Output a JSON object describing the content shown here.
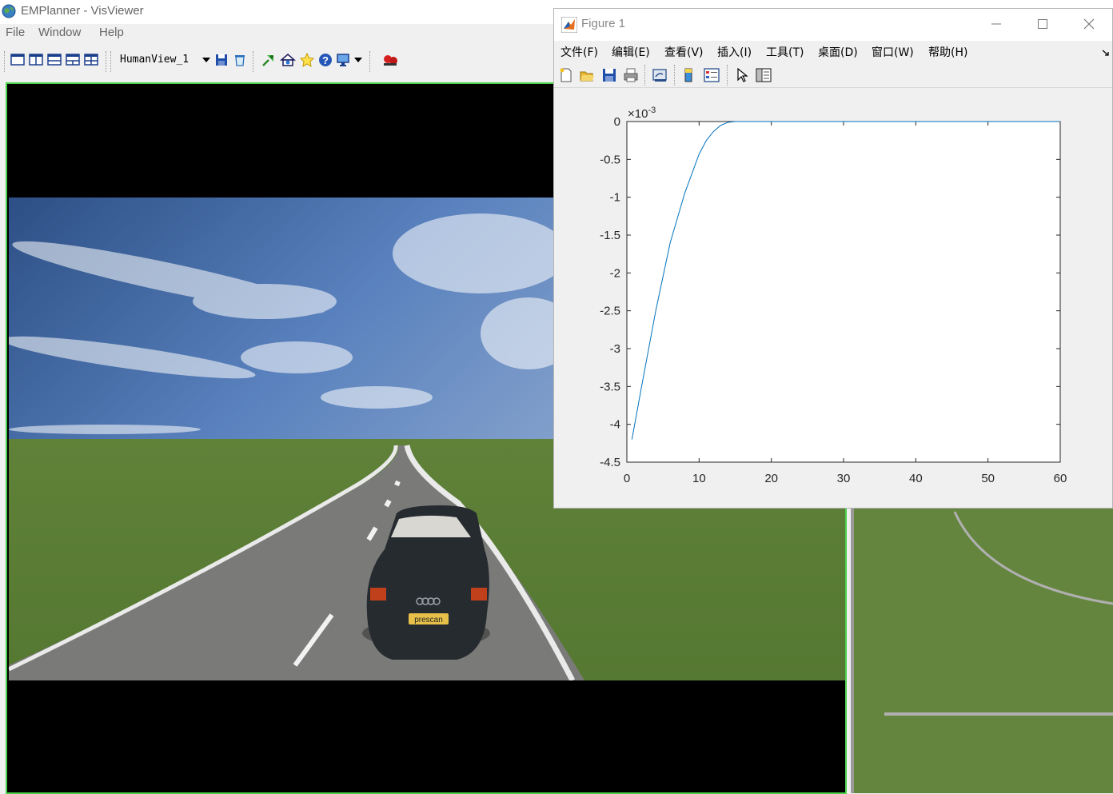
{
  "vis": {
    "title": "EMPlanner - VisViewer",
    "menu": [
      "File",
      "Window",
      "Help"
    ],
    "view_select": "HumanView_1",
    "toolbar_icons": [
      "layout-single-icon",
      "layout-two-columns-icon",
      "layout-two-rows-icon",
      "layout-three-icon",
      "layout-quad-icon",
      "save-icon",
      "delete-icon",
      "pick-icon",
      "home-view-icon",
      "favorite-icon",
      "help-icon",
      "display-icon",
      "record-icon"
    ],
    "plate_text": "prescan"
  },
  "figure": {
    "title": "Figure 1",
    "menu": [
      "文件(F)",
      "编辑(E)",
      "查看(V)",
      "插入(I)",
      "工具(T)",
      "桌面(D)",
      "窗口(W)",
      "帮助(H)"
    ],
    "toolbar_icons": [
      "new-figure-icon",
      "open-file-icon",
      "save-figure-icon",
      "print-icon",
      "link-icon",
      "colorbar-icon",
      "legend-icon",
      "pointer-icon",
      "property-inspector-icon"
    ],
    "window_buttons": [
      "minimize-icon",
      "maximize-icon",
      "close-icon"
    ]
  },
  "chart_data": {
    "type": "line",
    "title": "",
    "xlabel": "",
    "ylabel": "",
    "y_exponent_label": "×10",
    "y_exponent_power": "-3",
    "xlim": [
      0,
      60
    ],
    "ylim": [
      -4.5,
      0
    ],
    "x_ticks": [
      0,
      10,
      20,
      30,
      40,
      50,
      60
    ],
    "x_tick_labels": [
      "0",
      "10",
      "20",
      "30",
      "40",
      "50",
      "60"
    ],
    "y_ticks": [
      0,
      -0.5,
      -1,
      -1.5,
      -2,
      -2.5,
      -3,
      -3.5,
      -4,
      -4.5
    ],
    "y_tick_labels": [
      "0",
      "-0.5",
      "-1",
      "-1.5",
      "-2",
      "-2.5",
      "-3",
      "-3.5",
      "-4",
      "-4.5"
    ],
    "grid": false,
    "line_color": "#0072bd",
    "series": [
      {
        "x": [
          0.7,
          2,
          4,
          6,
          8,
          10,
          11,
          12,
          13,
          14,
          15,
          16,
          20,
          30,
          40,
          50,
          60
        ],
        "values": [
          -4.2,
          -3.52,
          -2.5,
          -1.6,
          -0.95,
          -0.43,
          -0.25,
          -0.13,
          -0.05,
          -0.01,
          0,
          0,
          0,
          0,
          0,
          0,
          0
        ]
      }
    ]
  }
}
